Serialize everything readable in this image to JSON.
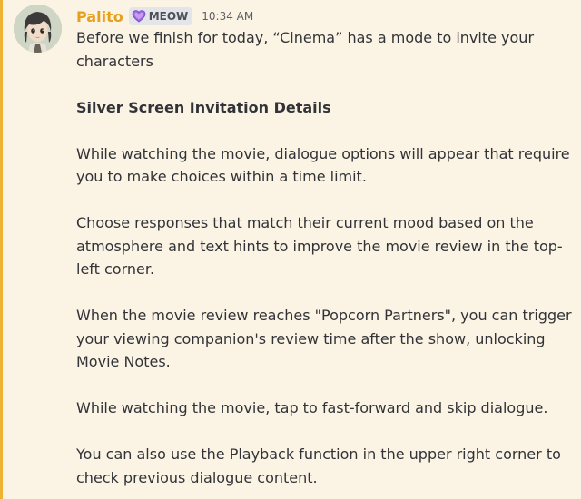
{
  "message": {
    "author": "Palito",
    "role_badge": "MEOW",
    "role_icon": "purple-heart-icon",
    "timestamp": "10:34 AM",
    "accent_color": "#f0b232",
    "username_color": "#e7a01d",
    "paragraphs": [
      "Before we finish for today, “Cinema” has a mode to invite your characters",
      "Silver Screen Invitation Details",
      "While watching the movie, dialogue options will appear that require you to make choices within a time limit.",
      "Choose responses that match their current mood based on the atmosphere and text hints to improve the movie review in the top-left corner.",
      "When the movie review reaches \"Popcorn Partners\", you can trigger your viewing companion's review time after the show, unlocking Movie Notes.",
      "While watching the movie, tap to fast-forward and skip dialogue.",
      "You can also use the Playback function in the upper right corner to check previous dialogue content."
    ]
  }
}
